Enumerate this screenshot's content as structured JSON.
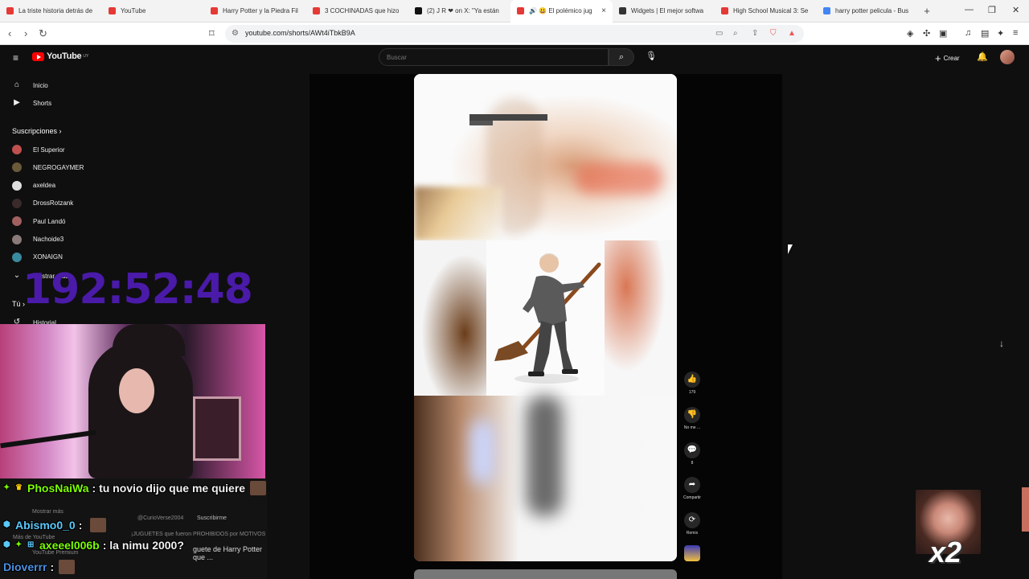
{
  "browser": {
    "tabs": [
      {
        "label": "La triste historia detrás de",
        "color": "#e53935"
      },
      {
        "label": "YouTube",
        "color": "#e53935"
      },
      {
        "label": "Harry Potter y la Piedra Fil",
        "color": "#e53935"
      },
      {
        "label": "3 COCHINADAS que hizo",
        "color": "#e53935"
      },
      {
        "label": "(2) J R ❤ on X: \"Ya están",
        "color": "#111111"
      },
      {
        "label": "🔊 😃 El polémico jug",
        "color": "#e53935",
        "active": true
      },
      {
        "label": "Widgets | El mejor softwa",
        "color": "#333333"
      },
      {
        "label": "High School Musical 3: Se",
        "color": "#e53935"
      },
      {
        "label": "harry potter pelicula - Bus",
        "color": "#4285f4"
      }
    ],
    "url": "youtube.com/shorts/AWt4iTbkB9A"
  },
  "youtube": {
    "logo_text": "YouTube",
    "logo_country": "UY",
    "search_placeholder": "Buscar",
    "create_label": "Crear"
  },
  "sidebar": {
    "main": [
      {
        "label": "Inicio",
        "icon": "home-icon"
      },
      {
        "label": "Shorts",
        "icon": "shorts-icon"
      }
    ],
    "subscriptions_title": "Suscripciones",
    "subscriptions": [
      {
        "label": "El Superior",
        "color": "#c0504d"
      },
      {
        "label": "NEGROGAYMER",
        "color": "#6a5a3a"
      },
      {
        "label": "axeldea",
        "color": "#e0e0e0"
      },
      {
        "label": "DrossRotzank",
        "color": "#3a2a2a"
      },
      {
        "label": "Paul Landó",
        "color": "#a06060"
      },
      {
        "label": "Nachoide3",
        "color": "#8a7a7a"
      },
      {
        "label": "XONAIGN",
        "color": "#3a8aa0"
      }
    ],
    "show_more": "Mostrar más",
    "you_title": "Tú",
    "history": "Historial"
  },
  "short": {
    "like_count": "179",
    "dislike_label": "No me ...",
    "comment_count": "8",
    "share_label": "Compartir",
    "remix_label": "Remix"
  },
  "stream": {
    "timer": "192:52:48",
    "chat": [
      {
        "user": "PhosNaiWa",
        "user_color": "#7cfc00",
        "message": "tu novio dijo que me quiere"
      },
      {
        "user": "Abismo0_0",
        "user_color": "#5ac8fa",
        "message": ""
      },
      {
        "user": "axeeel006b",
        "user_color": "#7cfc00",
        "message": "la nimu 2000?"
      },
      {
        "user": "Dioverrr",
        "user_color": "#4a90e2",
        "message": ""
      }
    ],
    "pip_label": "x2",
    "background_ghost": {
      "show_more": "Mostrar más",
      "more_youtube": "Más de YouTube",
      "premium": "YouTube Premium",
      "channel": "@CurioVerse2004",
      "subscribe": "Suscribirme",
      "video_title": "¡JUGUETES que fueron PROHIBIDOS por MOTIVOS",
      "video_title_2": "guete de Harry Potter que ..."
    }
  }
}
